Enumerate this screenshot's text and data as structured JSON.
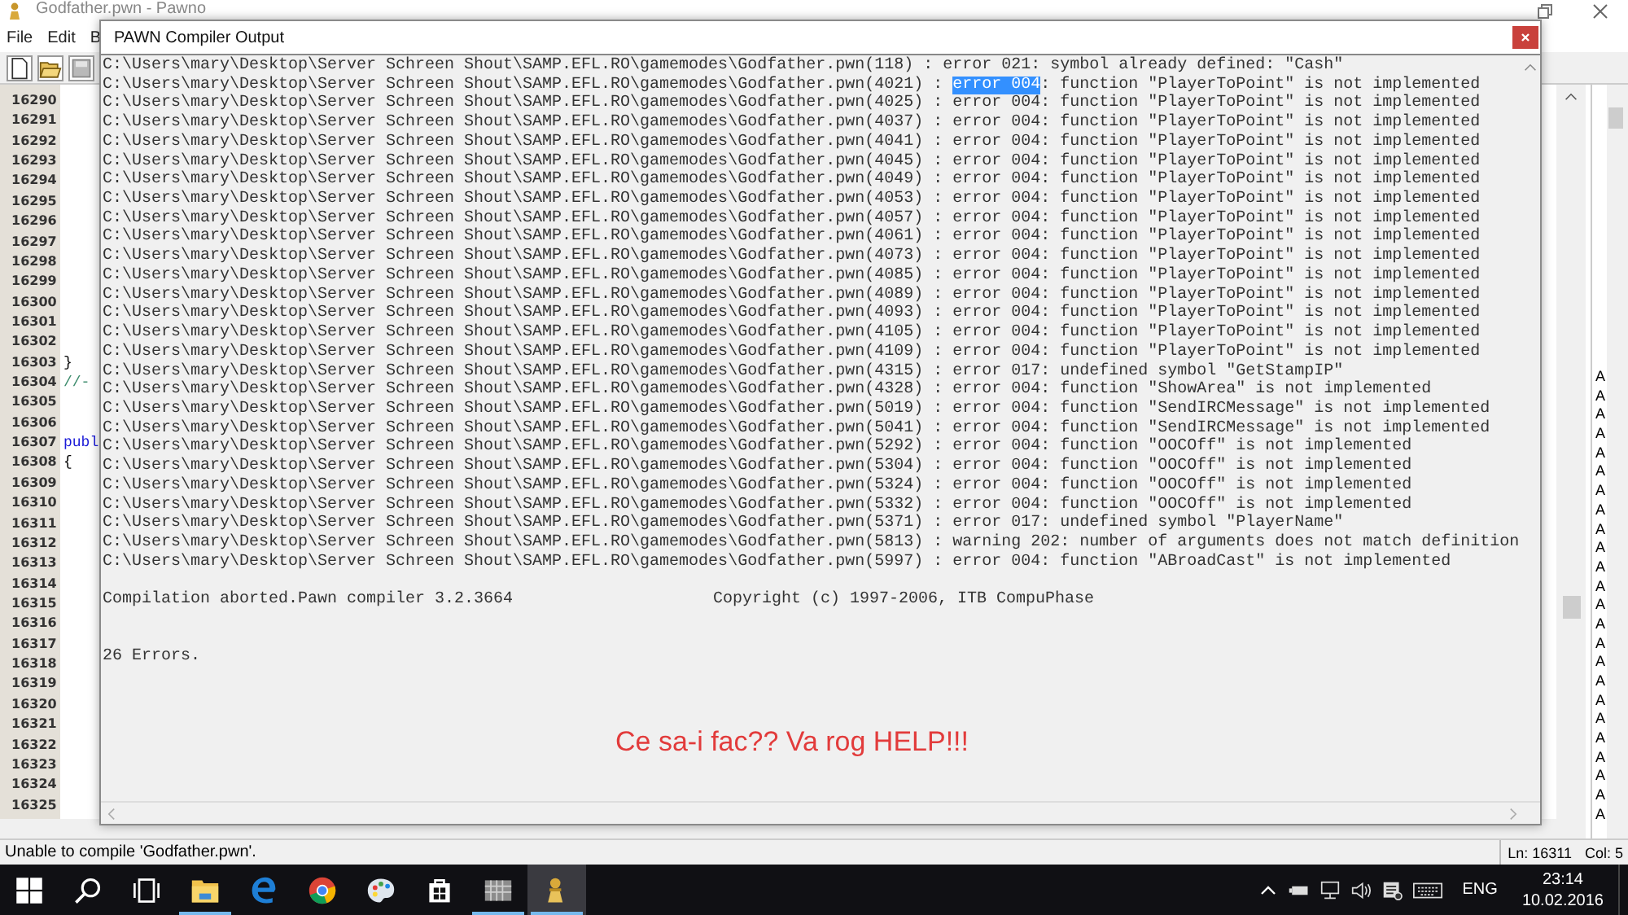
{
  "editor_window": {
    "title": "Godfather.pwn - Pawno",
    "menu": [
      "File",
      "Edit",
      "B"
    ],
    "rows": [
      {
        "number": "16290"
      },
      {
        "number": "16291"
      },
      {
        "number": "16292"
      },
      {
        "number": "16293"
      },
      {
        "number": "16294"
      },
      {
        "number": "16295"
      },
      {
        "number": "16296"
      },
      {
        "number": "16297"
      },
      {
        "number": "16298"
      },
      {
        "number": "16299"
      },
      {
        "number": "16300"
      },
      {
        "number": "16301"
      },
      {
        "number": "16302"
      },
      {
        "number": "16303",
        "code": "}",
        "kind": "plain"
      },
      {
        "number": "16304",
        "code": "//-",
        "kind": "comment"
      },
      {
        "number": "16305"
      },
      {
        "number": "16306"
      },
      {
        "number": "16307",
        "code": "publ",
        "kind": "keyword"
      },
      {
        "number": "16308",
        "code": "{",
        "kind": "plain"
      },
      {
        "number": "16309"
      },
      {
        "number": "16310"
      },
      {
        "number": "16311"
      },
      {
        "number": "16312"
      },
      {
        "number": "16313"
      },
      {
        "number": "16314"
      },
      {
        "number": "16315"
      },
      {
        "number": "16316"
      },
      {
        "number": "16317"
      },
      {
        "number": "16318"
      },
      {
        "number": "16319"
      },
      {
        "number": "16320"
      },
      {
        "number": "16321"
      },
      {
        "number": "16322"
      },
      {
        "number": "16323"
      },
      {
        "number": "16324"
      },
      {
        "number": "16325"
      }
    ],
    "side_panel": [
      "A",
      "A",
      "A",
      "A",
      "A",
      "A",
      "A",
      "A",
      "A",
      "A",
      "A",
      "A",
      "A",
      "A",
      "A",
      "A",
      "A",
      "A",
      "A",
      "A",
      "A",
      "A",
      "A",
      "A"
    ],
    "status": {
      "message": "Unable to compile 'Godfather.pwn'.",
      "line": "Ln: 16311",
      "column": "Col: 5"
    }
  },
  "dialog": {
    "title": "PAWN Compiler Output",
    "lines": [
      {
        "parts": [
          {
            "text": "C:\\Users\\mary\\Desktop\\Server Schreen Shout\\SAMP.EFL.RO\\gamemodes\\Godfather.pwn(118) : error 021: symbol already defined: \"Cash\"",
            "selected": false
          }
        ]
      },
      {
        "parts": [
          {
            "text": "C:\\Users\\mary\\Desktop\\Server Schreen Shout\\SAMP.EFL.RO\\gamemodes\\Godfather.pwn(4021) : ",
            "selected": false
          },
          {
            "text": "error 004",
            "selected": true
          },
          {
            "text": ": function \"PlayerToPoint\" is not implemented",
            "selected": false
          }
        ]
      },
      {
        "parts": [
          {
            "text": "C:\\Users\\mary\\Desktop\\Server Schreen Shout\\SAMP.EFL.RO\\gamemodes\\Godfather.pwn(4025) : error 004: function \"PlayerToPoint\" is not implemented",
            "selected": false
          }
        ]
      },
      {
        "parts": [
          {
            "text": "C:\\Users\\mary\\Desktop\\Server Schreen Shout\\SAMP.EFL.RO\\gamemodes\\Godfather.pwn(4037) : error 004: function \"PlayerToPoint\" is not implemented",
            "selected": false
          }
        ]
      },
      {
        "parts": [
          {
            "text": "C:\\Users\\mary\\Desktop\\Server Schreen Shout\\SAMP.EFL.RO\\gamemodes\\Godfather.pwn(4041) : error 004: function \"PlayerToPoint\" is not implemented",
            "selected": false
          }
        ]
      },
      {
        "parts": [
          {
            "text": "C:\\Users\\mary\\Desktop\\Server Schreen Shout\\SAMP.EFL.RO\\gamemodes\\Godfather.pwn(4045) : error 004: function \"PlayerToPoint\" is not implemented",
            "selected": false
          }
        ]
      },
      {
        "parts": [
          {
            "text": "C:\\Users\\mary\\Desktop\\Server Schreen Shout\\SAMP.EFL.RO\\gamemodes\\Godfather.pwn(4049) : error 004: function \"PlayerToPoint\" is not implemented",
            "selected": false
          }
        ]
      },
      {
        "parts": [
          {
            "text": "C:\\Users\\mary\\Desktop\\Server Schreen Shout\\SAMP.EFL.RO\\gamemodes\\Godfather.pwn(4053) : error 004: function \"PlayerToPoint\" is not implemented",
            "selected": false
          }
        ]
      },
      {
        "parts": [
          {
            "text": "C:\\Users\\mary\\Desktop\\Server Schreen Shout\\SAMP.EFL.RO\\gamemodes\\Godfather.pwn(4057) : error 004: function \"PlayerToPoint\" is not implemented",
            "selected": false
          }
        ]
      },
      {
        "parts": [
          {
            "text": "C:\\Users\\mary\\Desktop\\Server Schreen Shout\\SAMP.EFL.RO\\gamemodes\\Godfather.pwn(4061) : error 004: function \"PlayerToPoint\" is not implemented",
            "selected": false
          }
        ]
      },
      {
        "parts": [
          {
            "text": "C:\\Users\\mary\\Desktop\\Server Schreen Shout\\SAMP.EFL.RO\\gamemodes\\Godfather.pwn(4073) : error 004: function \"PlayerToPoint\" is not implemented",
            "selected": false
          }
        ]
      },
      {
        "parts": [
          {
            "text": "C:\\Users\\mary\\Desktop\\Server Schreen Shout\\SAMP.EFL.RO\\gamemodes\\Godfather.pwn(4085) : error 004: function \"PlayerToPoint\" is not implemented",
            "selected": false
          }
        ]
      },
      {
        "parts": [
          {
            "text": "C:\\Users\\mary\\Desktop\\Server Schreen Shout\\SAMP.EFL.RO\\gamemodes\\Godfather.pwn(4089) : error 004: function \"PlayerToPoint\" is not implemented",
            "selected": false
          }
        ]
      },
      {
        "parts": [
          {
            "text": "C:\\Users\\mary\\Desktop\\Server Schreen Shout\\SAMP.EFL.RO\\gamemodes\\Godfather.pwn(4093) : error 004: function \"PlayerToPoint\" is not implemented",
            "selected": false
          }
        ]
      },
      {
        "parts": [
          {
            "text": "C:\\Users\\mary\\Desktop\\Server Schreen Shout\\SAMP.EFL.RO\\gamemodes\\Godfather.pwn(4105) : error 004: function \"PlayerToPoint\" is not implemented",
            "selected": false
          }
        ]
      },
      {
        "parts": [
          {
            "text": "C:\\Users\\mary\\Desktop\\Server Schreen Shout\\SAMP.EFL.RO\\gamemodes\\Godfather.pwn(4109) : error 004: function \"PlayerToPoint\" is not implemented",
            "selected": false
          }
        ]
      },
      {
        "parts": [
          {
            "text": "C:\\Users\\mary\\Desktop\\Server Schreen Shout\\SAMP.EFL.RO\\gamemodes\\Godfather.pwn(4315) : error 017: undefined symbol \"GetStampIP\"",
            "selected": false
          }
        ]
      },
      {
        "parts": [
          {
            "text": "C:\\Users\\mary\\Desktop\\Server Schreen Shout\\SAMP.EFL.RO\\gamemodes\\Godfather.pwn(4328) : error 004: function \"ShowArea\" is not implemented",
            "selected": false
          }
        ]
      },
      {
        "parts": [
          {
            "text": "C:\\Users\\mary\\Desktop\\Server Schreen Shout\\SAMP.EFL.RO\\gamemodes\\Godfather.pwn(5019) : error 004: function \"SendIRCMessage\" is not implemented",
            "selected": false
          }
        ]
      },
      {
        "parts": [
          {
            "text": "C:\\Users\\mary\\Desktop\\Server Schreen Shout\\SAMP.EFL.RO\\gamemodes\\Godfather.pwn(5041) : error 004: function \"SendIRCMessage\" is not implemented",
            "selected": false
          }
        ]
      },
      {
        "parts": [
          {
            "text": "C:\\Users\\mary\\Desktop\\Server Schreen Shout\\SAMP.EFL.RO\\gamemodes\\Godfather.pwn(5292) : error 004: function \"OOCOff\" is not implemented",
            "selected": false
          }
        ]
      },
      {
        "parts": [
          {
            "text": "C:\\Users\\mary\\Desktop\\Server Schreen Shout\\SAMP.EFL.RO\\gamemodes\\Godfather.pwn(5304) : error 004: function \"OOCOff\" is not implemented",
            "selected": false
          }
        ]
      },
      {
        "parts": [
          {
            "text": "C:\\Users\\mary\\Desktop\\Server Schreen Shout\\SAMP.EFL.RO\\gamemodes\\Godfather.pwn(5324) : error 004: function \"OOCOff\" is not implemented",
            "selected": false
          }
        ]
      },
      {
        "parts": [
          {
            "text": "C:\\Users\\mary\\Desktop\\Server Schreen Shout\\SAMP.EFL.RO\\gamemodes\\Godfather.pwn(5332) : error 004: function \"OOCOff\" is not implemented",
            "selected": false
          }
        ]
      },
      {
        "parts": [
          {
            "text": "C:\\Users\\mary\\Desktop\\Server Schreen Shout\\SAMP.EFL.RO\\gamemodes\\Godfather.pwn(5371) : error 017: undefined symbol \"PlayerName\"",
            "selected": false
          }
        ]
      },
      {
        "parts": [
          {
            "text": "C:\\Users\\mary\\Desktop\\Server Schreen Shout\\SAMP.EFL.RO\\gamemodes\\Godfather.pwn(5813) : warning 202: number of arguments does not match definition",
            "selected": false
          }
        ]
      },
      {
        "parts": [
          {
            "text": "C:\\Users\\mary\\Desktop\\Server Schreen Shout\\SAMP.EFL.RO\\gamemodes\\Godfather.pwn(5997) : error 004: function \"ABroadCast\" is not implemented",
            "selected": false
          }
        ]
      }
    ],
    "summary": "Compilation aborted.Pawn compiler 3.2.3664",
    "copyright": "Copyright (c) 1997-2006, ITB CompuPhase",
    "error_count": "26 Errors.",
    "annotation": "Ce sa-i fac?? Va rog HELP!!!"
  },
  "taskbar": {
    "apps": [
      {
        "kind": "explorer",
        "open": true,
        "selected": false
      },
      {
        "kind": "edge",
        "open": false,
        "selected": false
      },
      {
        "kind": "chrome",
        "open": false,
        "selected": false
      },
      {
        "kind": "paint",
        "open": false,
        "selected": false
      },
      {
        "kind": "store",
        "open": false,
        "selected": false
      },
      {
        "kind": "grid",
        "open": true,
        "selected": false
      },
      {
        "kind": "pawno",
        "open": true,
        "selected": true
      }
    ],
    "language": "ENG",
    "time": "23:14",
    "date": "10.02.2016"
  }
}
